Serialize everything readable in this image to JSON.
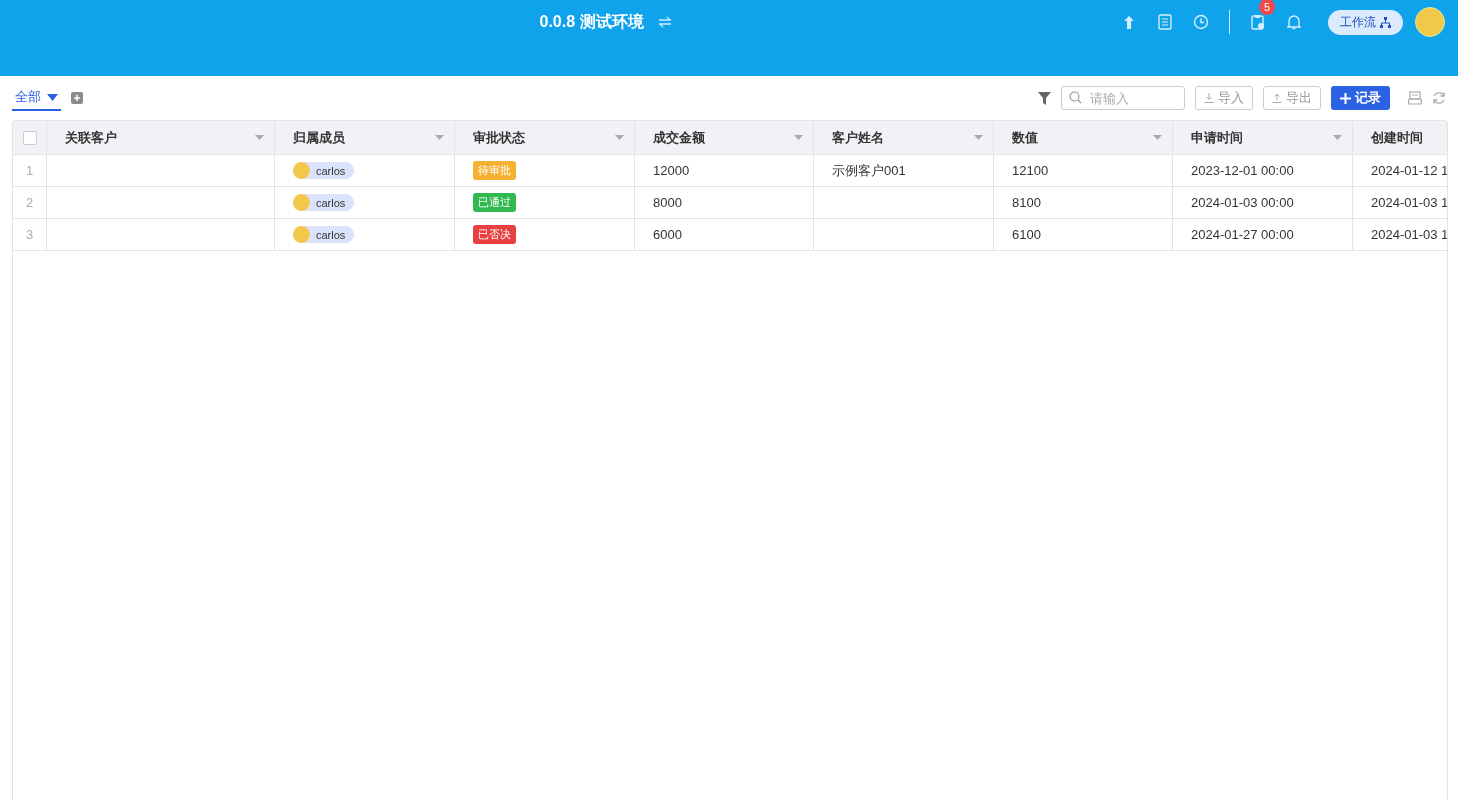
{
  "header": {
    "title": "0.0.8 测试环境",
    "notification_count": "5",
    "workflow_button": "工作流"
  },
  "toolbar": {
    "view_tab": {
      "label": "全部",
      "selected": true
    },
    "search": {
      "placeholder": "请输入"
    },
    "import_button": "导入",
    "export_button": "导出",
    "add_button": "记录"
  },
  "table": {
    "header_checkbox": {
      "checked": false
    },
    "columns": [
      {
        "label": "关联客户",
        "has_menu": true
      },
      {
        "label": "归属成员",
        "has_menu": true
      },
      {
        "label": "审批状态",
        "has_menu": true
      },
      {
        "label": "成交金额",
        "has_menu": true
      },
      {
        "label": "客户姓名",
        "has_menu": true
      },
      {
        "label": "数值",
        "has_menu": true
      },
      {
        "label": "申请时间",
        "has_menu": true
      },
      {
        "label": "创建时间",
        "has_menu": false
      }
    ],
    "rows": [
      {
        "number": "1",
        "cells": [
          {
            "kind": "blank"
          },
          {
            "kind": "member",
            "text": "carlos"
          },
          {
            "kind": "status",
            "text": "待审批",
            "color": "#f5b131"
          },
          {
            "kind": "text",
            "text": "12000"
          },
          {
            "kind": "text",
            "text": "示例客户001"
          },
          {
            "kind": "text",
            "text": "12100"
          },
          {
            "kind": "text",
            "text": "2023-12-01 00:00"
          },
          {
            "kind": "text",
            "text": "2024-01-12 1"
          }
        ]
      },
      {
        "number": "2",
        "cells": [
          {
            "kind": "blank"
          },
          {
            "kind": "member",
            "text": "carlos"
          },
          {
            "kind": "status",
            "text": "已通过",
            "color": "#2fb94f"
          },
          {
            "kind": "text",
            "text": "8000"
          },
          {
            "kind": "blank"
          },
          {
            "kind": "text",
            "text": "8100"
          },
          {
            "kind": "text",
            "text": "2024-01-03 00:00"
          },
          {
            "kind": "text",
            "text": "2024-01-03 1"
          }
        ]
      },
      {
        "number": "3",
        "cells": [
          {
            "kind": "blank"
          },
          {
            "kind": "member",
            "text": "carlos"
          },
          {
            "kind": "status",
            "text": "已否决",
            "color": "#e84040"
          },
          {
            "kind": "text",
            "text": "6000"
          },
          {
            "kind": "blank"
          },
          {
            "kind": "text",
            "text": "6100"
          },
          {
            "kind": "text",
            "text": "2024-01-27 00:00"
          },
          {
            "kind": "text",
            "text": "2024-01-03 1"
          }
        ]
      }
    ]
  }
}
